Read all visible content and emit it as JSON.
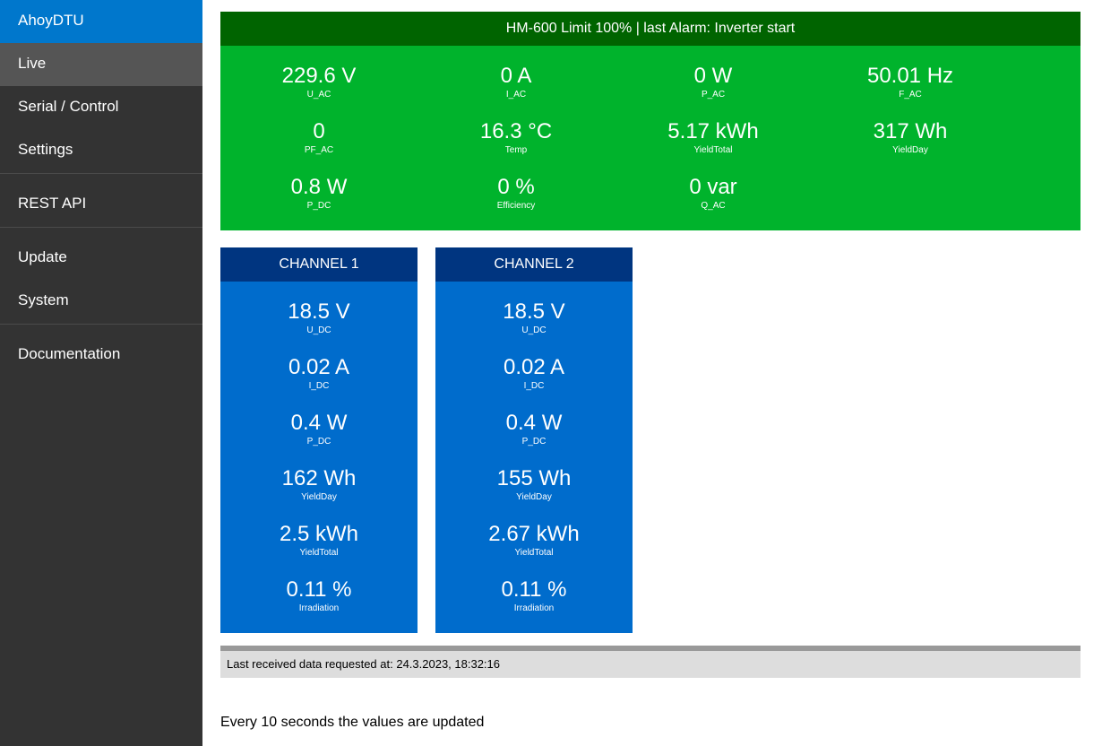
{
  "sidebar": {
    "brand": "AhoyDTU",
    "items": [
      "Live",
      "Serial / Control",
      "Settings",
      "REST API",
      "Update",
      "System",
      "Documentation"
    ]
  },
  "inverter": {
    "header": "HM-600 Limit 100% | last Alarm: Inverter start",
    "metrics": [
      {
        "value": "229.6 V",
        "label": "U_AC"
      },
      {
        "value": "0 A",
        "label": "I_AC"
      },
      {
        "value": "0 W",
        "label": "P_AC"
      },
      {
        "value": "50.01 Hz",
        "label": "F_AC"
      },
      {
        "value": "0",
        "label": "PF_AC"
      },
      {
        "value": "16.3 °C",
        "label": "Temp"
      },
      {
        "value": "5.17 kWh",
        "label": "YieldTotal"
      },
      {
        "value": "317 Wh",
        "label": "YieldDay"
      },
      {
        "value": "0.8 W",
        "label": "P_DC"
      },
      {
        "value": "0 %",
        "label": "Efficiency"
      },
      {
        "value": "0 var",
        "label": "Q_AC"
      }
    ]
  },
  "channels": [
    {
      "title": "CHANNEL 1",
      "metrics": [
        {
          "value": "18.5 V",
          "label": "U_DC"
        },
        {
          "value": "0.02 A",
          "label": "I_DC"
        },
        {
          "value": "0.4 W",
          "label": "P_DC"
        },
        {
          "value": "162 Wh",
          "label": "YieldDay"
        },
        {
          "value": "2.5 kWh",
          "label": "YieldTotal"
        },
        {
          "value": "0.11 %",
          "label": "Irradiation"
        }
      ]
    },
    {
      "title": "CHANNEL 2",
      "metrics": [
        {
          "value": "18.5 V",
          "label": "U_DC"
        },
        {
          "value": "0.02 A",
          "label": "I_DC"
        },
        {
          "value": "0.4 W",
          "label": "P_DC"
        },
        {
          "value": "155 Wh",
          "label": "YieldDay"
        },
        {
          "value": "2.67 kWh",
          "label": "YieldTotal"
        },
        {
          "value": "0.11 %",
          "label": "Irradiation"
        }
      ]
    }
  ],
  "status": {
    "last_received": "Last received data requested at: 24.3.2023, 18:32:16"
  },
  "footer_note": "Every 10 seconds the values are updated"
}
